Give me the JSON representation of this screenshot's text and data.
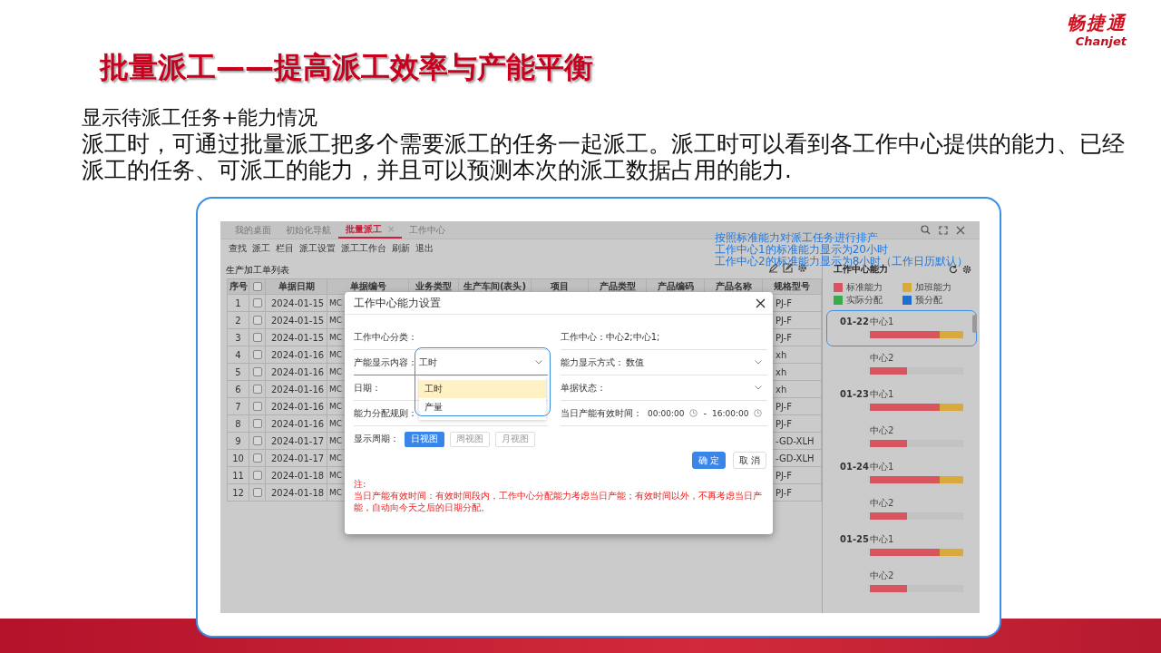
{
  "slide": {
    "title": "批量派工——提高派工效率与产能平衡",
    "logo": {
      "name": "畅捷通",
      "latin": "Chanjet"
    },
    "heading": "显示待派工任务+能力情况",
    "description": "派工时，可通过批量派工把多个需要派工的任务一起派工。派工时可以看到各工作中心提供的能力、已经派工的任务、可派工的能力，并且可以预测本次的派工数据占用的能力."
  },
  "app": {
    "tabs": [
      {
        "label": "我的桌面",
        "selected": false
      },
      {
        "label": "初始化导航",
        "selected": false
      },
      {
        "label": "批量派工",
        "selected": true,
        "close": "×"
      },
      {
        "label": "工作中心",
        "selected": false
      }
    ],
    "toolbar": [
      "查找",
      "派工",
      "栏目",
      "派工设置",
      "派工工作台",
      "刷新",
      "退出"
    ],
    "list_title": "生产加工单列表",
    "annotation": [
      "按照标准能力对派工任务进行排产",
      "工作中心1的标准能力显示为20小时",
      "工作中心2的标准能力显示为8小时（工作日历默认）"
    ],
    "table": {
      "columns": [
        {
          "kind": "text",
          "label": "序号"
        },
        {
          "kind": "checkbox",
          "checked": false
        },
        {
          "kind": "text",
          "label": "单据日期"
        },
        {
          "kind": "text",
          "label": "单据编号"
        },
        {
          "kind": "text",
          "label": "业务类型"
        },
        {
          "kind": "text",
          "label": "生产车间(表头)"
        },
        {
          "kind": "text",
          "label": "项目"
        },
        {
          "kind": "text",
          "label": "产品类型"
        },
        {
          "kind": "text",
          "label": "产品编码"
        },
        {
          "kind": "text",
          "label": "产品名称"
        },
        {
          "kind": "text",
          "label": "规格型号"
        }
      ],
      "rows": [
        {
          "no": "1",
          "checked": false,
          "date": "2024-01-15",
          "code": "MC",
          "spec": "PJ-F"
        },
        {
          "no": "2",
          "checked": false,
          "date": "2024-01-15",
          "code": "MC",
          "spec": "PJ-F"
        },
        {
          "no": "3",
          "checked": false,
          "date": "2024-01-15",
          "code": "MC",
          "spec": "PJ-F"
        },
        {
          "no": "4",
          "checked": false,
          "date": "2024-01-16",
          "code": "MC",
          "spec": "xh"
        },
        {
          "no": "5",
          "checked": false,
          "date": "2024-01-16",
          "code": "MC",
          "spec": "xh"
        },
        {
          "no": "6",
          "checked": false,
          "date": "2024-01-16",
          "code": "MC",
          "spec": "xh"
        },
        {
          "no": "7",
          "checked": false,
          "date": "2024-01-16",
          "code": "MC",
          "spec": "PJ-F"
        },
        {
          "no": "8",
          "checked": false,
          "date": "2024-01-16",
          "code": "MC",
          "spec": "PJ-F"
        },
        {
          "no": "9",
          "checked": false,
          "date": "2024-01-17",
          "code": "MC",
          "spec": "-GD-XLH"
        },
        {
          "no": "10",
          "checked": false,
          "date": "2024-01-17",
          "code": "MC",
          "spec": "-GD-XLH"
        },
        {
          "no": "11",
          "checked": false,
          "date": "2024-01-18",
          "code": "MC",
          "spec": "PJ-F"
        },
        {
          "no": "12",
          "checked": false,
          "date": "2024-01-18",
          "code": "MC",
          "spec": "PJ-F"
        }
      ]
    },
    "capacity_panel": {
      "title": "工作中心能力",
      "legend": [
        {
          "label": "标准能力",
          "color": "#d9545f"
        },
        {
          "label": "加班能力",
          "color": "#d9aa3a"
        },
        {
          "label": "实际分配",
          "color": "#3aaa4a"
        },
        {
          "label": "预分配",
          "color": "#1f6fd0"
        }
      ],
      "days": [
        {
          "date": "01-22",
          "centers": [
            {
              "name": "中心1",
              "highlighted": true,
              "segments": [
                {
                  "color": "#d9545f",
                  "level": 0.75
                },
                {
                  "color": "#d9aa3a",
                  "level": 0.25
                }
              ]
            },
            {
              "name": "中心2",
              "highlighted": false,
              "segments": [
                {
                  "color": "#d9545f",
                  "level": 0.4
                }
              ]
            }
          ]
        },
        {
          "date": "01-23",
          "centers": [
            {
              "name": "中心1",
              "highlighted": false,
              "segments": [
                {
                  "color": "#d9545f",
                  "level": 0.75
                },
                {
                  "color": "#d9aa3a",
                  "level": 0.25
                }
              ]
            },
            {
              "name": "中心2",
              "highlighted": false,
              "segments": [
                {
                  "color": "#d9545f",
                  "level": 0.4
                }
              ]
            }
          ]
        },
        {
          "date": "01-24",
          "centers": [
            {
              "name": "中心1",
              "highlighted": false,
              "segments": [
                {
                  "color": "#d9545f",
                  "level": 0.75
                },
                {
                  "color": "#d9aa3a",
                  "level": 0.25
                }
              ]
            },
            {
              "name": "中心2",
              "highlighted": false,
              "segments": [
                {
                  "color": "#d9545f",
                  "level": 0.4
                }
              ]
            }
          ]
        },
        {
          "date": "01-25",
          "centers": [
            {
              "name": "中心1",
              "highlighted": false,
              "segments": [
                {
                  "color": "#d9545f",
                  "level": 0.75
                },
                {
                  "color": "#d9aa3a",
                  "level": 0.25
                }
              ]
            },
            {
              "name": "中心2",
              "highlighted": false,
              "segments": [
                {
                  "color": "#d9545f",
                  "level": 0.4
                }
              ]
            }
          ]
        }
      ]
    },
    "dialog": {
      "title": "工作中心能力设置",
      "left": [
        {
          "kind": "text",
          "label": "工作中心分类："
        },
        {
          "kind": "select",
          "label": "产能显示内容：",
          "value": "工时",
          "open": true,
          "highlighted": true,
          "options": [
            {
              "label": "工时",
              "selected": true
            },
            {
              "label": "产量",
              "selected": false
            }
          ]
        },
        {
          "kind": "text",
          "label": "日期："
        },
        {
          "kind": "text",
          "label": "能力分配规则："
        },
        {
          "kind": "period",
          "label": "显示周期：",
          "options": [
            {
              "label": "日视图",
              "selected": true
            },
            {
              "label": "周视图",
              "selected": false
            },
            {
              "label": "月视图",
              "selected": false
            }
          ]
        }
      ],
      "right": [
        {
          "kind": "text",
          "label": "工作中心：",
          "value": "中心2;中心1;"
        },
        {
          "kind": "select",
          "label": "能力显示方式：",
          "value": "数值",
          "open": false,
          "highlighted": false
        },
        {
          "kind": "select",
          "label": "单据状态：",
          "open": false,
          "highlighted": false
        },
        {
          "kind": "time_range",
          "label": "当日产能有效时间：",
          "start": "00:00:00",
          "separator": "-",
          "end": "16:00:00"
        }
      ],
      "buttons": [
        {
          "label": "确 定",
          "primary": true
        },
        {
          "label": "取 消",
          "primary": false
        }
      ],
      "note": {
        "title": "注:",
        "text": "当日产能有效时间：有效时间段内，工作中心分配能力考虑当日产能；有效时间以外，不再考虑当日产能，自动向今天之后的日期分配。"
      }
    }
  }
}
